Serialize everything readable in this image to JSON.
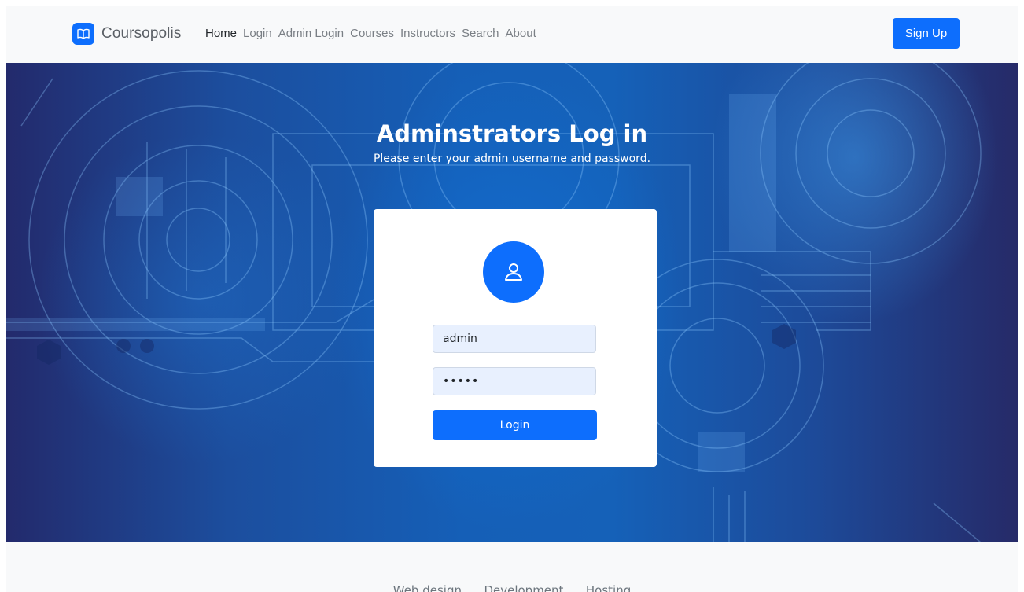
{
  "navbar": {
    "brand": "Coursopolis",
    "brand_icon": "book-icon",
    "links": [
      {
        "label": "Home",
        "active": true
      },
      {
        "label": "Login"
      },
      {
        "label": "Admin Login"
      },
      {
        "label": "Courses"
      },
      {
        "label": "Instructors"
      },
      {
        "label": "Search"
      },
      {
        "label": "About"
      }
    ],
    "signup_label": "Sign Up"
  },
  "hero": {
    "title": "Adminstrators Log in",
    "subtitle": "Please enter your admin username and password."
  },
  "login_form": {
    "avatar_icon": "user-icon",
    "username_value": "admin",
    "password_value": "12345",
    "submit_label": "Login"
  },
  "footer": {
    "links": [
      "Web design",
      "Development",
      "Hosting"
    ]
  },
  "colors": {
    "primary": "#0d6efd",
    "hero_dark": "#232a6c",
    "hero_light": "#1561b8",
    "navbar_bg": "#f8f9fa"
  }
}
